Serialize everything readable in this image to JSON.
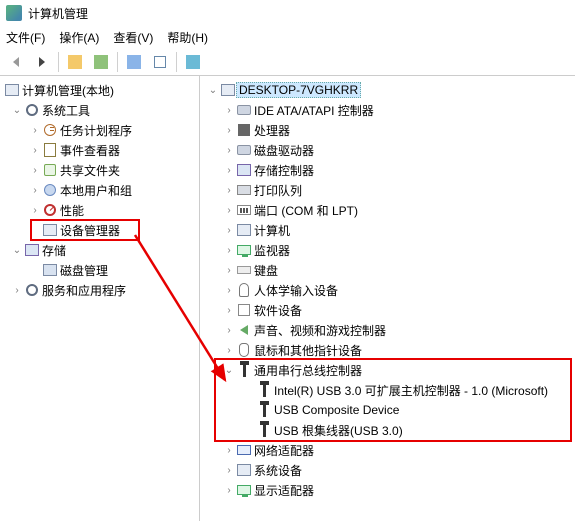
{
  "window": {
    "title": "计算机管理"
  },
  "menu": {
    "file": "文件(F)",
    "action": "操作(A)",
    "view": "查看(V)",
    "help": "帮助(H)"
  },
  "left_tree": {
    "root": "计算机管理(本地)",
    "sys_tools": "系统工具",
    "task_sched": "任务计划程序",
    "event_viewer": "事件查看器",
    "shared": "共享文件夹",
    "local_users": "本地用户和组",
    "perf": "性能",
    "dev_mgr": "设备管理器",
    "storage": "存储",
    "disk_mgmt": "磁盘管理",
    "services": "服务和应用程序"
  },
  "right_tree": {
    "host": "DESKTOP-7VGHKRR",
    "ide": "IDE ATA/ATAPI 控制器",
    "cpu": "处理器",
    "disk_drive": "磁盘驱动器",
    "storage_ctrl": "存储控制器",
    "print_queue": "打印队列",
    "ports": "端口 (COM 和 LPT)",
    "computer": "计算机",
    "monitor": "监视器",
    "keyboard": "键盘",
    "hid": "人体学输入设备",
    "software": "软件设备",
    "sound": "声音、视频和游戏控制器",
    "mouse": "鼠标和其他指针设备",
    "usb_ctrl": "通用串行总线控制器",
    "usb_intel": "Intel(R) USB 3.0 可扩展主机控制器 - 1.0 (Microsoft)",
    "usb_comp": "USB Composite Device",
    "usb_hub": "USB 根集线器(USB 3.0)",
    "net": "网络适配器",
    "sysdev": "系统设备",
    "display": "显示适配器"
  }
}
